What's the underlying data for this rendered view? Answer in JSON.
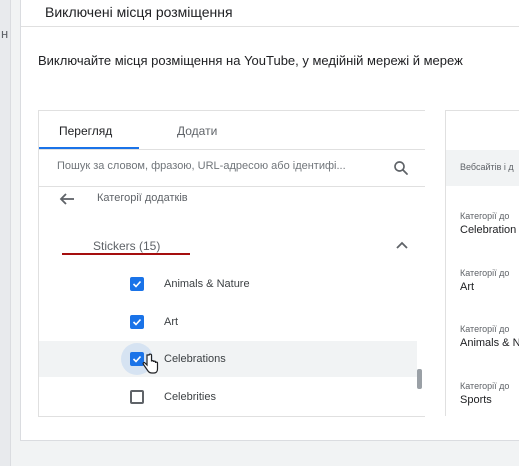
{
  "left_strip": {
    "glyph": "н"
  },
  "card": {
    "title": "Виключені місця розміщення",
    "description": "Виключайте місця розміщення на YouTube, у медійній мережі й мереж"
  },
  "tabs": [
    {
      "label": "Перегляд",
      "active": true
    },
    {
      "label": "Додати",
      "active": false
    }
  ],
  "search": {
    "placeholder": "Пошук за словом, фразою, URL-адресою або ідентифі..."
  },
  "breadcrumb": {
    "label": "Категорії додатків"
  },
  "group": {
    "label": "Stickers (15)",
    "expanded": true
  },
  "items": [
    {
      "label": "Animals & Nature",
      "checked": true
    },
    {
      "label": "Art",
      "checked": true
    },
    {
      "label": "Celebrations",
      "checked": true
    },
    {
      "label": "Celebrities",
      "checked": false
    }
  ],
  "right_panel": {
    "header": "Вебсайтів і д",
    "items": [
      {
        "key": "Категорії до",
        "value": "Celebration"
      },
      {
        "key": "Категорії до",
        "value": "Art"
      },
      {
        "key": "Категорії до",
        "value": "Animals & N"
      },
      {
        "key": "Категорії до",
        "value": "Sports"
      }
    ]
  },
  "colors": {
    "accent": "#1a73e8",
    "annotation": "#a50e0e"
  }
}
